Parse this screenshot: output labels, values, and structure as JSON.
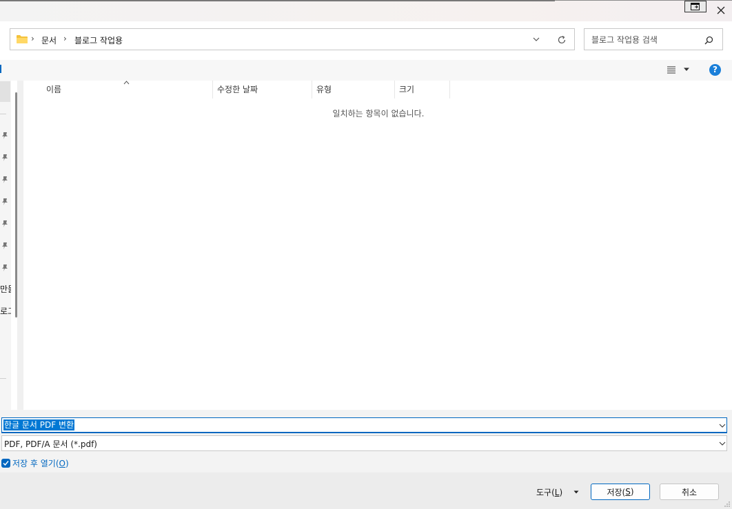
{
  "address": {
    "breadcrumb": [
      {
        "label": "문서"
      },
      {
        "label": "블로그 작업용"
      }
    ]
  },
  "search": {
    "placeholder": "블로그 작업용 검색"
  },
  "columns": [
    {
      "label": "이름"
    },
    {
      "label": "수정한 날짜"
    },
    {
      "label": "유형"
    },
    {
      "label": "크기"
    }
  ],
  "empty_message": "일치하는 항목이 없습니다.",
  "nav_partial": [
    "만들",
    "로그"
  ],
  "filename": {
    "value": "한글 문서 PDF 변환"
  },
  "filetype": {
    "value": "PDF, PDF/A 문서 (*.pdf)"
  },
  "open_after_save": {
    "label": "저장 후 열기(",
    "mnemonic": "O",
    "suffix": ")",
    "checked": true
  },
  "buttons": {
    "tools": {
      "label": "도구(",
      "mnemonic": "L",
      "suffix": ")"
    },
    "save": {
      "label": "저장(",
      "mnemonic": "S",
      "suffix": ")"
    },
    "cancel": {
      "label": "취소"
    }
  },
  "colors": {
    "accent": "#0067c0",
    "selection": "#0078d4"
  }
}
